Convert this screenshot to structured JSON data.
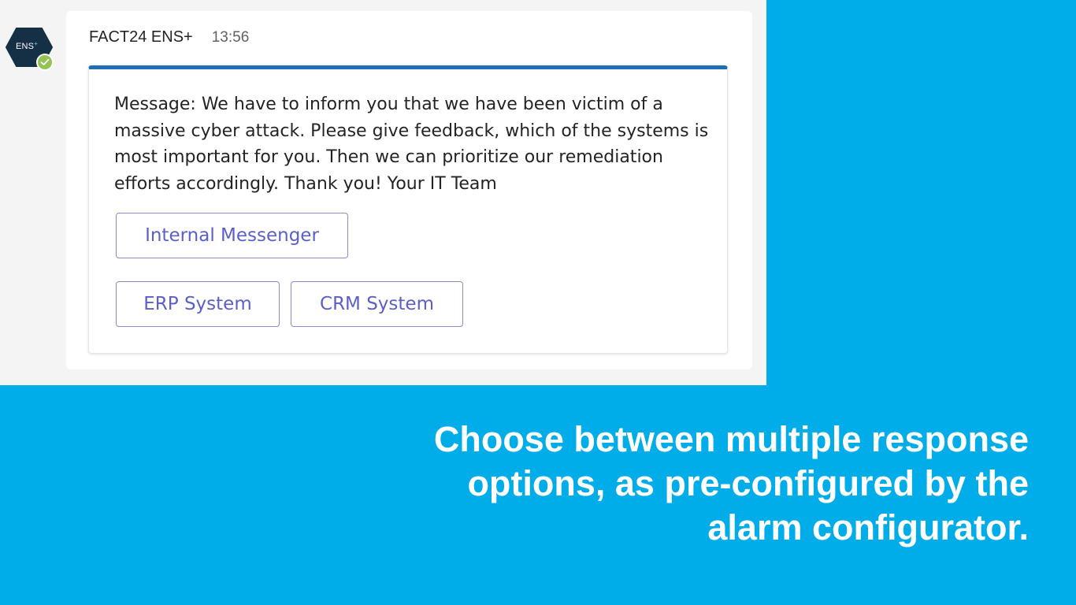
{
  "message": {
    "avatar_label": "ENS",
    "avatar_plus": "+",
    "sender_name": "FACT24 ENS+",
    "timestamp": "13:56",
    "status": "available",
    "body": "Message: We have to inform you that we have been victim of a massive cyber attack. Please give feedback, which of the systems is most important for you. Then we can prioritize our remediation efforts accordingly. Thank you! Your IT Team",
    "actions": [
      {
        "label": "Internal Messenger"
      },
      {
        "label": "ERP System"
      },
      {
        "label": "CRM System"
      }
    ]
  },
  "caption": "Choose between multiple response options, as pre-configured by the alarm configurator.",
  "colors": {
    "background_accent": "#00ade9",
    "card_top_bar": "#1f6fb6",
    "button_text": "#5b5fc7",
    "status_available": "#92c353",
    "avatar_hex": "#152f45"
  }
}
